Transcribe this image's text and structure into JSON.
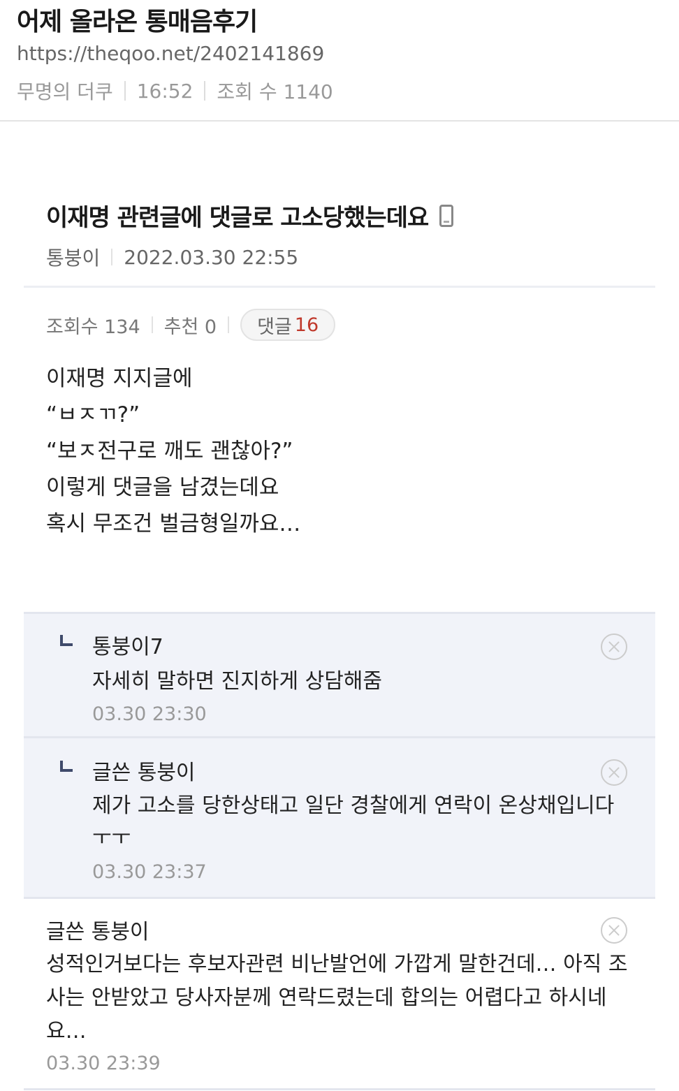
{
  "share_header": {
    "title": "어제 올라온 통매음후기",
    "url": "https://theqoo.net/2402141869",
    "author": "무명의 더쿠",
    "time": "16:52",
    "views": "조회 수 1140"
  },
  "post": {
    "title": "이재명 관련글에 댓글로 고소당했는데요",
    "author": "통붕이",
    "datetime": "2022.03.30 22:55",
    "stats": {
      "views": "조회수 134",
      "likes": "추천 0",
      "comments_label": "댓글",
      "comments_count": "16"
    },
    "body_lines": [
      "이재명 지지글에",
      "“ㅂㅈㄲ?”",
      "“보ㅈ전구로 깨도 괜찮아?”",
      "이렇게 댓글을 남겼는데요",
      "혹시 무조건 벌금형일까요…"
    ]
  },
  "comments": [
    {
      "author": "통붕이7",
      "text": "자세히 말하면 진지하게 상담해줌",
      "time": "03.30 23:30"
    },
    {
      "author": "글쓴 통붕이",
      "text": "제가 고소를 당한상태고 일단 경찰에게 연락이 온상채입니다 ㅜㅜ",
      "time": "03.30 23:37"
    },
    {
      "author": "글쓴 통붕이",
      "text": "성적인거보다는 후보자관련 비난발언에 가깝게 말한건데… 아직 조사는 안받았고 당사자분께 연락드렸는데 합의는 어렵다고 하시네요…",
      "time": "03.30 23:39"
    }
  ]
}
